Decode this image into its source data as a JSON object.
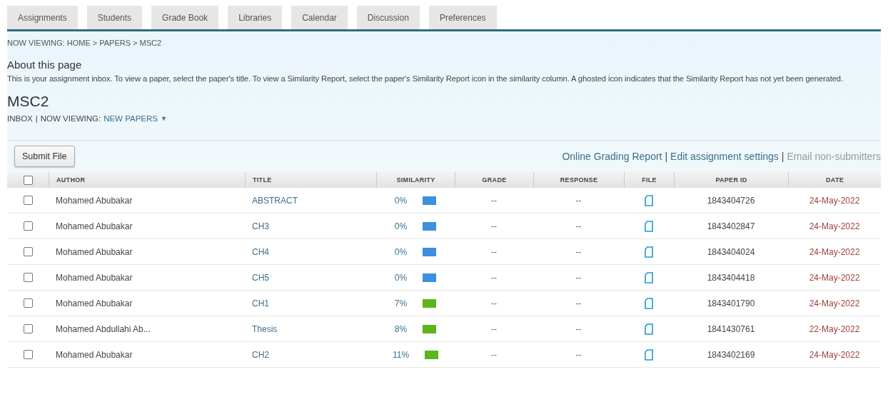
{
  "tabs": [
    "Assignments",
    "Students",
    "Grade Book",
    "Libraries",
    "Calendar",
    "Discussion",
    "Preferences"
  ],
  "breadcrumb": "NOW VIEWING: HOME > PAPERS > MSC2",
  "about": {
    "title": "About this page",
    "text": "This is your assignment inbox. To view a paper, select the paper's title. To view a Similarity Report, select the paper's Similarity Report icon in the similarity column. A ghosted icon indicates that the Similarity Report has not yet been generated."
  },
  "assignment": {
    "title": "MSC2",
    "inbox": "INBOX",
    "separator": "|",
    "viewing_label": "NOW VIEWING:",
    "viewing_value": "NEW PAPERS",
    "caret": "▼"
  },
  "toolbar": {
    "submit_button": "Submit File",
    "links": [
      {
        "label": "Online Grading Report",
        "disabled": false
      },
      {
        "label": "Edit assignment settings",
        "disabled": false
      },
      {
        "label": "Email non-submitters",
        "disabled": true
      }
    ],
    "separator": "|"
  },
  "table": {
    "all_checked": false,
    "columns": [
      "AUTHOR",
      "TITLE",
      "SIMILARITY",
      "GRADE",
      "RESPONSE",
      "FILE",
      "PAPER ID",
      "DATE"
    ],
    "rows": [
      {
        "checked": false,
        "author": "Mohamed Abubakar",
        "title": "ABSTRACT",
        "similarity": "0%",
        "color": "#3d8fe0",
        "grade": "--",
        "response": "--",
        "paper_id": "1843404726",
        "date": "24-May-2022"
      },
      {
        "checked": false,
        "author": "Mohamed Abubakar",
        "title": "CH3",
        "similarity": "0%",
        "color": "#3d8fe0",
        "grade": "--",
        "response": "--",
        "paper_id": "1843402847",
        "date": "24-May-2022"
      },
      {
        "checked": false,
        "author": "Mohamed Abubakar",
        "title": "CH4",
        "similarity": "0%",
        "color": "#3d8fe0",
        "grade": "--",
        "response": "--",
        "paper_id": "1843404024",
        "date": "24-May-2022"
      },
      {
        "checked": false,
        "author": "Mohamed Abubakar",
        "title": "CH5",
        "similarity": "0%",
        "color": "#3d8fe0",
        "grade": "--",
        "response": "--",
        "paper_id": "1843404418",
        "date": "24-May-2022"
      },
      {
        "checked": false,
        "author": "Mohamed Abubakar",
        "title": "CH1",
        "similarity": "7%",
        "color": "#5bb51b",
        "grade": "--",
        "response": "--",
        "paper_id": "1843401790",
        "date": "24-May-2022"
      },
      {
        "checked": false,
        "author": "Mohamed Abdullahi Ab...",
        "title": "Thesis",
        "similarity": "8%",
        "color": "#5bb51b",
        "grade": "--",
        "response": "--",
        "paper_id": "1841430761",
        "date": "22-May-2022"
      },
      {
        "checked": false,
        "author": "Mohamed Abubakar",
        "title": "CH2",
        "similarity": "11%",
        "color": "#5bb51b",
        "grade": "--",
        "response": "--",
        "paper_id": "1843402169",
        "date": "24-May-2022"
      }
    ]
  }
}
